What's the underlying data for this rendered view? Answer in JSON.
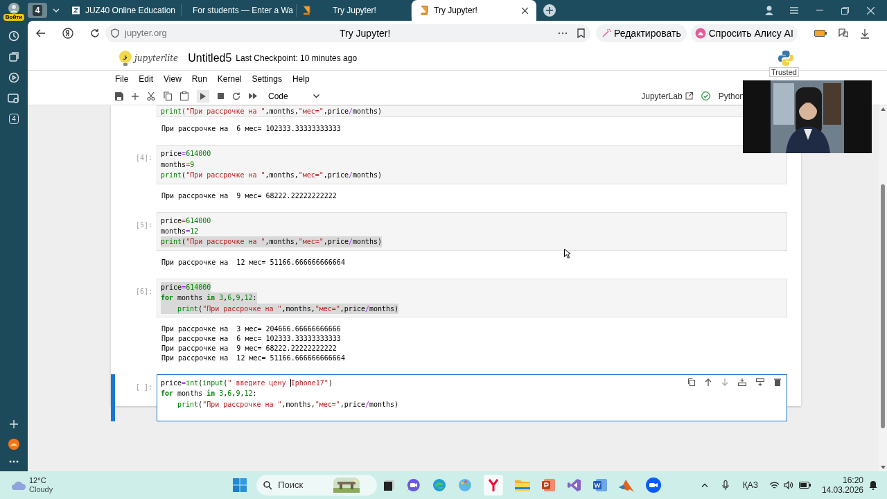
{
  "browser": {
    "login_badge": "Войти",
    "workspace_count": "4",
    "sidebar_badge": "4",
    "tabs": [
      {
        "label": "JUZ40 Online Education",
        "selected": false
      },
      {
        "label": "For students — Enter a Wa",
        "selected": false
      },
      {
        "label": "Try Jupyter!",
        "selected": false
      },
      {
        "label": "Try Jupyter!",
        "selected": true
      }
    ],
    "url": "jupyter.org",
    "page_title": "Try Jupyter!",
    "edit_button": "Редактировать",
    "alice_button": "Спросить Алису AI"
  },
  "notebook": {
    "logo_text": "jupyterlite",
    "title": "Untitled5",
    "checkpoint": "Last Checkpoint: 10 minutes ago",
    "trusted": "Trusted",
    "menu": [
      "File",
      "Edit",
      "View",
      "Run",
      "Kernel",
      "Settings",
      "Help"
    ],
    "cell_type": "Code",
    "lab_link": "JupyterLab",
    "kernel": "Python",
    "cells": [
      {
        "active": false,
        "lines": [
          {
            "selected": false,
            "indented": false,
            "tokens": [
              {
                "text": "print",
                "kind": "builtin"
              },
              {
                "text": "(\"При рассрочке на \"",
                "kind": "string"
              },
              {
                "text": ",months,",
                "kind": "plain"
              },
              {
                "text": "\"мес=\"",
                "kind": "string"
              },
              {
                "text": ",price",
                "kind": "plain"
              },
              {
                "text": "/",
                "kind": "operator"
              },
              {
                "text": "months)",
                "kind": "plain"
              }
            ]
          }
        ],
        "outputs": [
          "При рассрочке на  6 мес= 102333.33333333333"
        ]
      },
      {
        "prompt": "[4]:",
        "active": false,
        "lines": [
          {
            "selected": false,
            "indented": false,
            "tokens": [
              {
                "text": "price",
                "kind": "plain"
              },
              {
                "text": "=",
                "kind": "operator"
              },
              {
                "text": "614000",
                "kind": "number"
              }
            ]
          },
          {
            "selected": false,
            "indented": false,
            "tokens": [
              {
                "text": "months",
                "kind": "plain"
              },
              {
                "text": "=",
                "kind": "operator"
              },
              {
                "text": "9",
                "kind": "number"
              }
            ]
          },
          {
            "selected": false,
            "indented": false,
            "tokens": [
              {
                "text": "print",
                "kind": "builtin"
              },
              {
                "text": "(",
                "kind": "plain"
              },
              {
                "text": "\"При рассрочке на \"",
                "kind": "string"
              },
              {
                "text": ",months,",
                "kind": "plain"
              },
              {
                "text": "\"мес=\"",
                "kind": "string"
              },
              {
                "text": ",price",
                "kind": "plain"
              },
              {
                "text": "/",
                "kind": "operator"
              },
              {
                "text": "months)",
                "kind": "plain"
              }
            ]
          }
        ],
        "outputs": [
          "При рассрочке на  9 мес= 68222.22222222222"
        ]
      },
      {
        "prompt": "[5]:",
        "active": false,
        "lines": [
          {
            "selected": false,
            "indented": false,
            "tokens": [
              {
                "text": "price",
                "kind": "plain"
              },
              {
                "text": "=",
                "kind": "operator"
              },
              {
                "text": "614000",
                "kind": "number"
              }
            ]
          },
          {
            "selected": false,
            "indented": false,
            "tokens": [
              {
                "text": "months",
                "kind": "plain"
              },
              {
                "text": "=",
                "kind": "operator"
              },
              {
                "text": "12",
                "kind": "number"
              }
            ]
          },
          {
            "selected": true,
            "indented": false,
            "tokens": [
              {
                "text": "print",
                "kind": "builtin"
              },
              {
                "text": "(",
                "kind": "plain"
              },
              {
                "text": "\"При рассрочке на \"",
                "kind": "string"
              },
              {
                "text": ",months,",
                "kind": "plain"
              },
              {
                "text": "\"мес=\"",
                "kind": "string"
              },
              {
                "text": ",price",
                "kind": "plain"
              },
              {
                "text": "/",
                "kind": "operator"
              },
              {
                "text": "months)",
                "kind": "plain"
              }
            ]
          }
        ],
        "outputs": [
          "При рассрочке на  12 мес= 51166.666666666664"
        ]
      },
      {
        "prompt": "[6]:",
        "active": false,
        "lines": [
          {
            "selected": true,
            "indented": false,
            "tokens": [
              {
                "text": "price",
                "kind": "plain"
              },
              {
                "text": "=",
                "kind": "operator"
              },
              {
                "text": "614000",
                "kind": "number"
              }
            ]
          },
          {
            "selected": true,
            "indented": false,
            "tokens": [
              {
                "text": "for",
                "kind": "keyword"
              },
              {
                "text": " months ",
                "kind": "plain"
              },
              {
                "text": "in",
                "kind": "keyword"
              },
              {
                "text": " 3",
                "kind": "number"
              },
              {
                "text": ",",
                "kind": "plain"
              },
              {
                "text": "6",
                "kind": "number"
              },
              {
                "text": ",",
                "kind": "plain"
              },
              {
                "text": "9",
                "kind": "number"
              },
              {
                "text": ",",
                "kind": "plain"
              },
              {
                "text": "12",
                "kind": "number"
              },
              {
                "text": ":",
                "kind": "plain"
              }
            ]
          },
          {
            "selected": true,
            "indented": true,
            "tokens": [
              {
                "text": "print",
                "kind": "builtin"
              },
              {
                "text": "(",
                "kind": "plain"
              },
              {
                "text": "\"При рассрочке на \"",
                "kind": "string"
              },
              {
                "text": ",months,",
                "kind": "plain"
              },
              {
                "text": "\"мес=\"",
                "kind": "string"
              },
              {
                "text": ",price",
                "kind": "plain"
              },
              {
                "text": "/",
                "kind": "operator"
              },
              {
                "text": "months)",
                "kind": "plain"
              }
            ]
          }
        ],
        "outputs": [
          "При рассрочке на  3 мес= 204666.66666666666",
          "При рассрочке на  6 мес= 102333.33333333333",
          "При рассрочке на  9 мес= 68222.22222222222",
          "При рассрочке на  12 мес= 51166.666666666664"
        ]
      },
      {
        "prompt": "[ ]:",
        "active": true,
        "lines": [
          {
            "selected": false,
            "indented": false,
            "tokens": [
              {
                "text": "price",
                "kind": "plain"
              },
              {
                "text": "=",
                "kind": "operator"
              },
              {
                "text": "int",
                "kind": "builtin"
              },
              {
                "text": "(",
                "kind": "plain"
              },
              {
                "text": "input",
                "kind": "builtin"
              },
              {
                "text": "(",
                "kind": "plain"
              },
              {
                "text": "\" введите цену ",
                "kind": "string"
              },
              {
                "text": "Iphone17\"",
                "kind": "string",
                "caret": true
              },
              {
                "text": ")",
                "kind": "plain"
              }
            ]
          },
          {
            "selected": false,
            "indented": false,
            "tokens": [
              {
                "text": "for",
                "kind": "keyword"
              },
              {
                "text": " months ",
                "kind": "plain"
              },
              {
                "text": "in",
                "kind": "keyword"
              },
              {
                "text": " 3",
                "kind": "number"
              },
              {
                "text": ",",
                "kind": "plain"
              },
              {
                "text": "6",
                "kind": "number"
              },
              {
                "text": ",",
                "kind": "plain"
              },
              {
                "text": "9",
                "kind": "number"
              },
              {
                "text": ",",
                "kind": "plain"
              },
              {
                "text": "12",
                "kind": "number"
              },
              {
                "text": ":",
                "kind": "plain"
              }
            ]
          },
          {
            "selected": false,
            "indented": true,
            "tokens": [
              {
                "text": "print",
                "kind": "builtin"
              },
              {
                "text": "(",
                "kind": "plain"
              },
              {
                "text": "\"При рассрочке на \"",
                "kind": "string"
              },
              {
                "text": ",months,",
                "kind": "plain"
              },
              {
                "text": "\"мес=\"",
                "kind": "string"
              },
              {
                "text": ",price",
                "kind": "plain"
              },
              {
                "text": "/",
                "kind": "operator"
              },
              {
                "text": "months)",
                "kind": "plain"
              }
            ]
          }
        ]
      }
    ]
  },
  "taskbar": {
    "temperature": "12°C",
    "weather": "Cloudy",
    "search_placeholder": "Поиск",
    "language": "ҚАЗ",
    "time": "16:20",
    "date": "14.03.2026"
  }
}
